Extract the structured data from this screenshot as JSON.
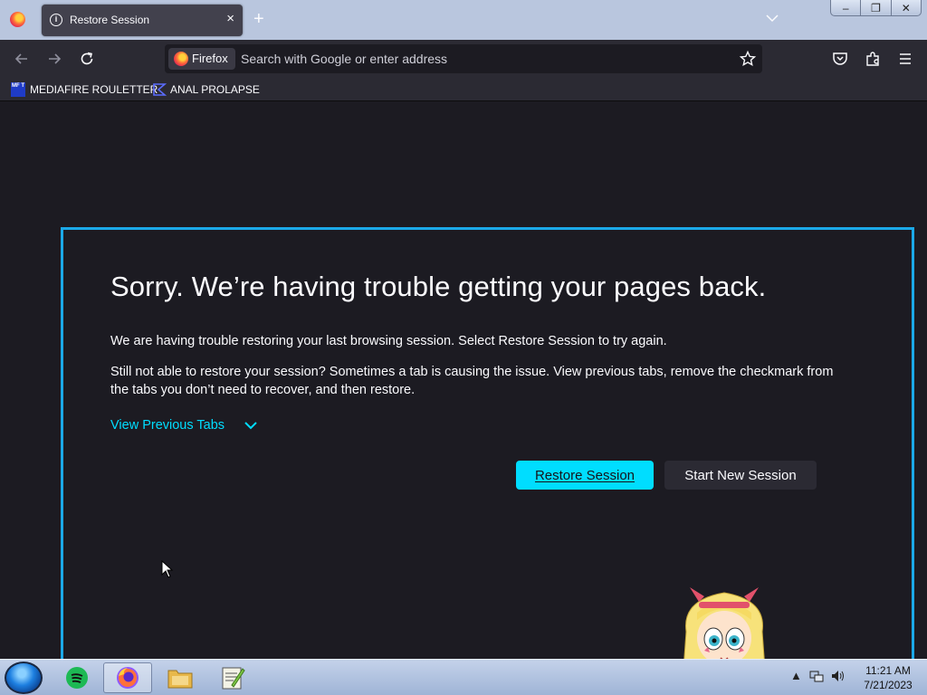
{
  "window": {
    "tab_title": "Restore Session",
    "tab_close": "×",
    "new_tab": "+",
    "controls": {
      "minimize": "–",
      "restore": "❐",
      "close": "✕"
    }
  },
  "navbar": {
    "identity_label": "Firefox",
    "url_placeholder": "Search with Google or enter address",
    "url_value": ""
  },
  "bookmarks": [
    {
      "label": "MEDIAFIRE ROULETTER",
      "icon_text": "MF T",
      "icon": "mediafire-icon"
    },
    {
      "label": "ANAL PROLAPSE",
      "icon": "bookmark-favicon"
    }
  ],
  "page": {
    "title": "Sorry. We’re having trouble getting your pages back.",
    "paragraph1": "We are having trouble restoring your last browsing session. Select Restore Session to try again.",
    "paragraph2": "Still not able to restore your session? Sometimes a tab is causing the issue. View previous tabs, remove the checkmark from the tabs you don’t need to recover, and then restore.",
    "view_previous_label": "View Previous Tabs",
    "restore_button": "Restore Session",
    "new_session_button": "Start New Session"
  },
  "taskbar": {
    "apps": [
      "spotify-icon",
      "firefox-icon",
      "file-explorer-icon",
      "notepad-plus-icon"
    ],
    "active_app": "firefox-icon",
    "time": "11:21 AM",
    "date": "7/21/2023"
  },
  "colors": {
    "accent": "#00ddff",
    "frame_border": "#1ba9e8",
    "page_bg": "#1c1b22",
    "toolbar_bg": "#2b2a33"
  }
}
